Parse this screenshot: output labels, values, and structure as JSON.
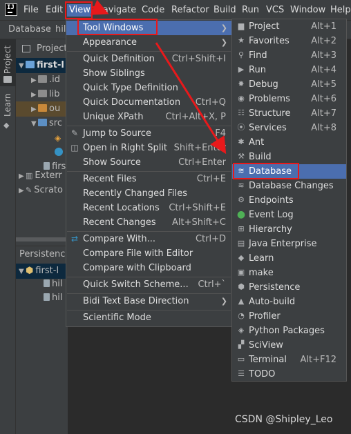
{
  "app": {
    "logo_text": "IJ"
  },
  "menubar": {
    "items": [
      "File",
      "Edit",
      "View",
      "Navigate",
      "Code",
      "Refactor",
      "Build",
      "Run",
      "VCS",
      "Window",
      "Help"
    ],
    "active": "View"
  },
  "breadcrumb": {
    "items": [
      "Database",
      "hil"
    ]
  },
  "strip": {
    "tabs": [
      "Project",
      "Learn"
    ]
  },
  "project_panel": {
    "header": "Project",
    "rows": [
      "first-l",
      ".id",
      "lib",
      "ou",
      "src",
      "",
      "",
      "firs",
      "Exterr",
      "Scrato"
    ],
    "persistence_header": "Persistence",
    "persistence_rows": [
      "first-l",
      "hil",
      "hil"
    ]
  },
  "view_menu": {
    "items": [
      {
        "label": "Tool Windows",
        "submenu": true,
        "highlighted": true,
        "icon": ""
      },
      {
        "label": "Appearance",
        "submenu": true,
        "icon": ""
      },
      {
        "label": "Quick Definition",
        "shortcut": "Ctrl+Shift+I"
      },
      {
        "label": "Show Siblings",
        "shortcut": ""
      },
      {
        "label": "Quick Type Definition",
        "shortcut": ""
      },
      {
        "label": "Quick Documentation",
        "shortcut": "Ctrl+Q"
      },
      {
        "label": "Unique XPath",
        "shortcut": "Ctrl+Alt+X, P"
      },
      {
        "label": "Jump to Source",
        "shortcut": "F4",
        "icon": "pencil-icon"
      },
      {
        "label": "Open in Right Split",
        "shortcut": "Shift+Enter",
        "icon": "split-icon"
      },
      {
        "label": "Show Source",
        "shortcut": "Ctrl+Enter"
      },
      {
        "label": "Recent Files",
        "shortcut": "Ctrl+E"
      },
      {
        "label": "Recently Changed Files",
        "shortcut": ""
      },
      {
        "label": "Recent Locations",
        "shortcut": "Ctrl+Shift+E"
      },
      {
        "label": "Recent Changes",
        "shortcut": "Alt+Shift+C"
      },
      {
        "label": "Compare With...",
        "shortcut": "Ctrl+D",
        "icon": "compare-icon"
      },
      {
        "label": "Compare File with Editor",
        "shortcut": ""
      },
      {
        "label": "Compare with Clipboard",
        "shortcut": ""
      },
      {
        "label": "Quick Switch Scheme...",
        "shortcut": "Ctrl+`"
      },
      {
        "label": "Bidi Text Base Direction",
        "submenu": true
      },
      {
        "label": "Scientific Mode",
        "shortcut": ""
      }
    ]
  },
  "tool_windows": {
    "items": [
      {
        "label": "Project",
        "shortcut": "Alt+1",
        "icon": "folder-icon"
      },
      {
        "label": "Favorites",
        "shortcut": "Alt+2",
        "icon": "star-icon"
      },
      {
        "label": "Find",
        "shortcut": "Alt+3",
        "icon": "search-icon"
      },
      {
        "label": "Run",
        "shortcut": "Alt+4",
        "icon": "play-icon"
      },
      {
        "label": "Debug",
        "shortcut": "Alt+5",
        "icon": "bug-icon"
      },
      {
        "label": "Problems",
        "shortcut": "Alt+6",
        "icon": "problems-icon"
      },
      {
        "label": "Structure",
        "shortcut": "Alt+7",
        "icon": "structure-icon"
      },
      {
        "label": "Services",
        "shortcut": "Alt+8",
        "icon": "services-icon"
      },
      {
        "label": "Ant",
        "shortcut": "",
        "icon": "ant-icon"
      },
      {
        "label": "Build",
        "shortcut": "",
        "icon": "hammer-icon"
      },
      {
        "label": "Database",
        "shortcut": "",
        "icon": "database-icon",
        "highlighted": true
      },
      {
        "label": "Database Changes",
        "shortcut": "",
        "icon": "database-changes-icon"
      },
      {
        "label": "Endpoints",
        "shortcut": "",
        "icon": "endpoints-icon"
      },
      {
        "label": "Event Log",
        "shortcut": "",
        "icon": "event-log-icon"
      },
      {
        "label": "Hierarchy",
        "shortcut": "",
        "icon": "hierarchy-icon"
      },
      {
        "label": "Java Enterprise",
        "shortcut": "",
        "icon": "java-enterprise-icon"
      },
      {
        "label": "Learn",
        "shortcut": "",
        "icon": "learn-icon"
      },
      {
        "label": "make",
        "shortcut": "",
        "icon": "make-icon"
      },
      {
        "label": "Persistence",
        "shortcut": "",
        "icon": "persistence-icon"
      },
      {
        "label": "Auto-build",
        "shortcut": "",
        "icon": "auto-build-icon"
      },
      {
        "label": "Profiler",
        "shortcut": "",
        "icon": "profiler-icon"
      },
      {
        "label": "Python Packages",
        "shortcut": "",
        "icon": "python-packages-icon"
      },
      {
        "label": "SciView",
        "shortcut": "",
        "icon": "sciview-icon"
      },
      {
        "label": "Terminal",
        "shortcut": "Alt+F12",
        "icon": "terminal-icon"
      },
      {
        "label": "TODO",
        "shortcut": "",
        "icon": "todo-icon"
      }
    ]
  },
  "watermark": "CSDN @Shipley_Leo",
  "colors": {
    "highlight": "#4b6eaf",
    "annotation_red": "#e8191b",
    "menu_bg": "#3c3f41"
  }
}
